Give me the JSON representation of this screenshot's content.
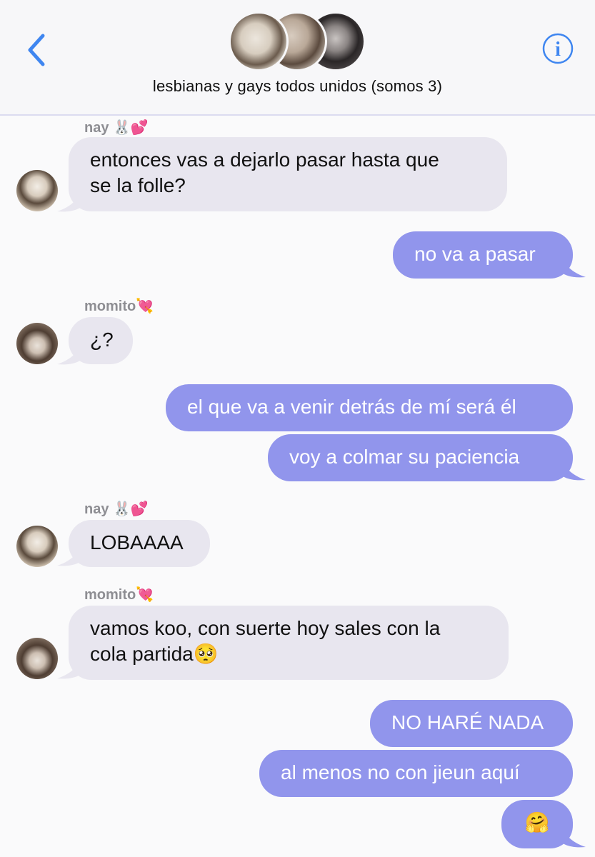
{
  "header": {
    "title": "lesbianas y gays todos unidos (somos 3)",
    "back_icon": "chevron-left-icon",
    "info_icon": "info-icon",
    "info_glyph": "i",
    "accent_color": "#3f86f0"
  },
  "colors": {
    "incoming_bubble": "#e8e6ef",
    "outgoing_bubble": "#9195ec"
  },
  "messages": [
    {
      "sender": "nay",
      "sender_emoji": "🐰💕",
      "text_lines": [
        "entonces vas a dejarlo pasar hasta que",
        "se la folle?"
      ],
      "direction": "incoming"
    },
    {
      "text": "no va a pasar",
      "direction": "outgoing"
    },
    {
      "sender": "momito",
      "sender_emoji": "💘",
      "text": "¿?",
      "direction": "incoming"
    },
    {
      "text": "el que va a venir detrás de mí será él",
      "direction": "outgoing"
    },
    {
      "text": "voy a colmar su paciencia",
      "direction": "outgoing"
    },
    {
      "sender": "nay",
      "sender_emoji": "🐰💕",
      "text": "LOBAAAA",
      "direction": "incoming"
    },
    {
      "sender": "momito",
      "sender_emoji": "💘",
      "text_lines": [
        "vamos koo, con suerte hoy sales con la",
        "cola partida🥺"
      ],
      "direction": "incoming"
    },
    {
      "text": "NO HARÉ NADA",
      "direction": "outgoing"
    },
    {
      "text": "al menos no con jieun aquí",
      "direction": "outgoing"
    },
    {
      "text": "🤗",
      "direction": "outgoing"
    }
  ]
}
